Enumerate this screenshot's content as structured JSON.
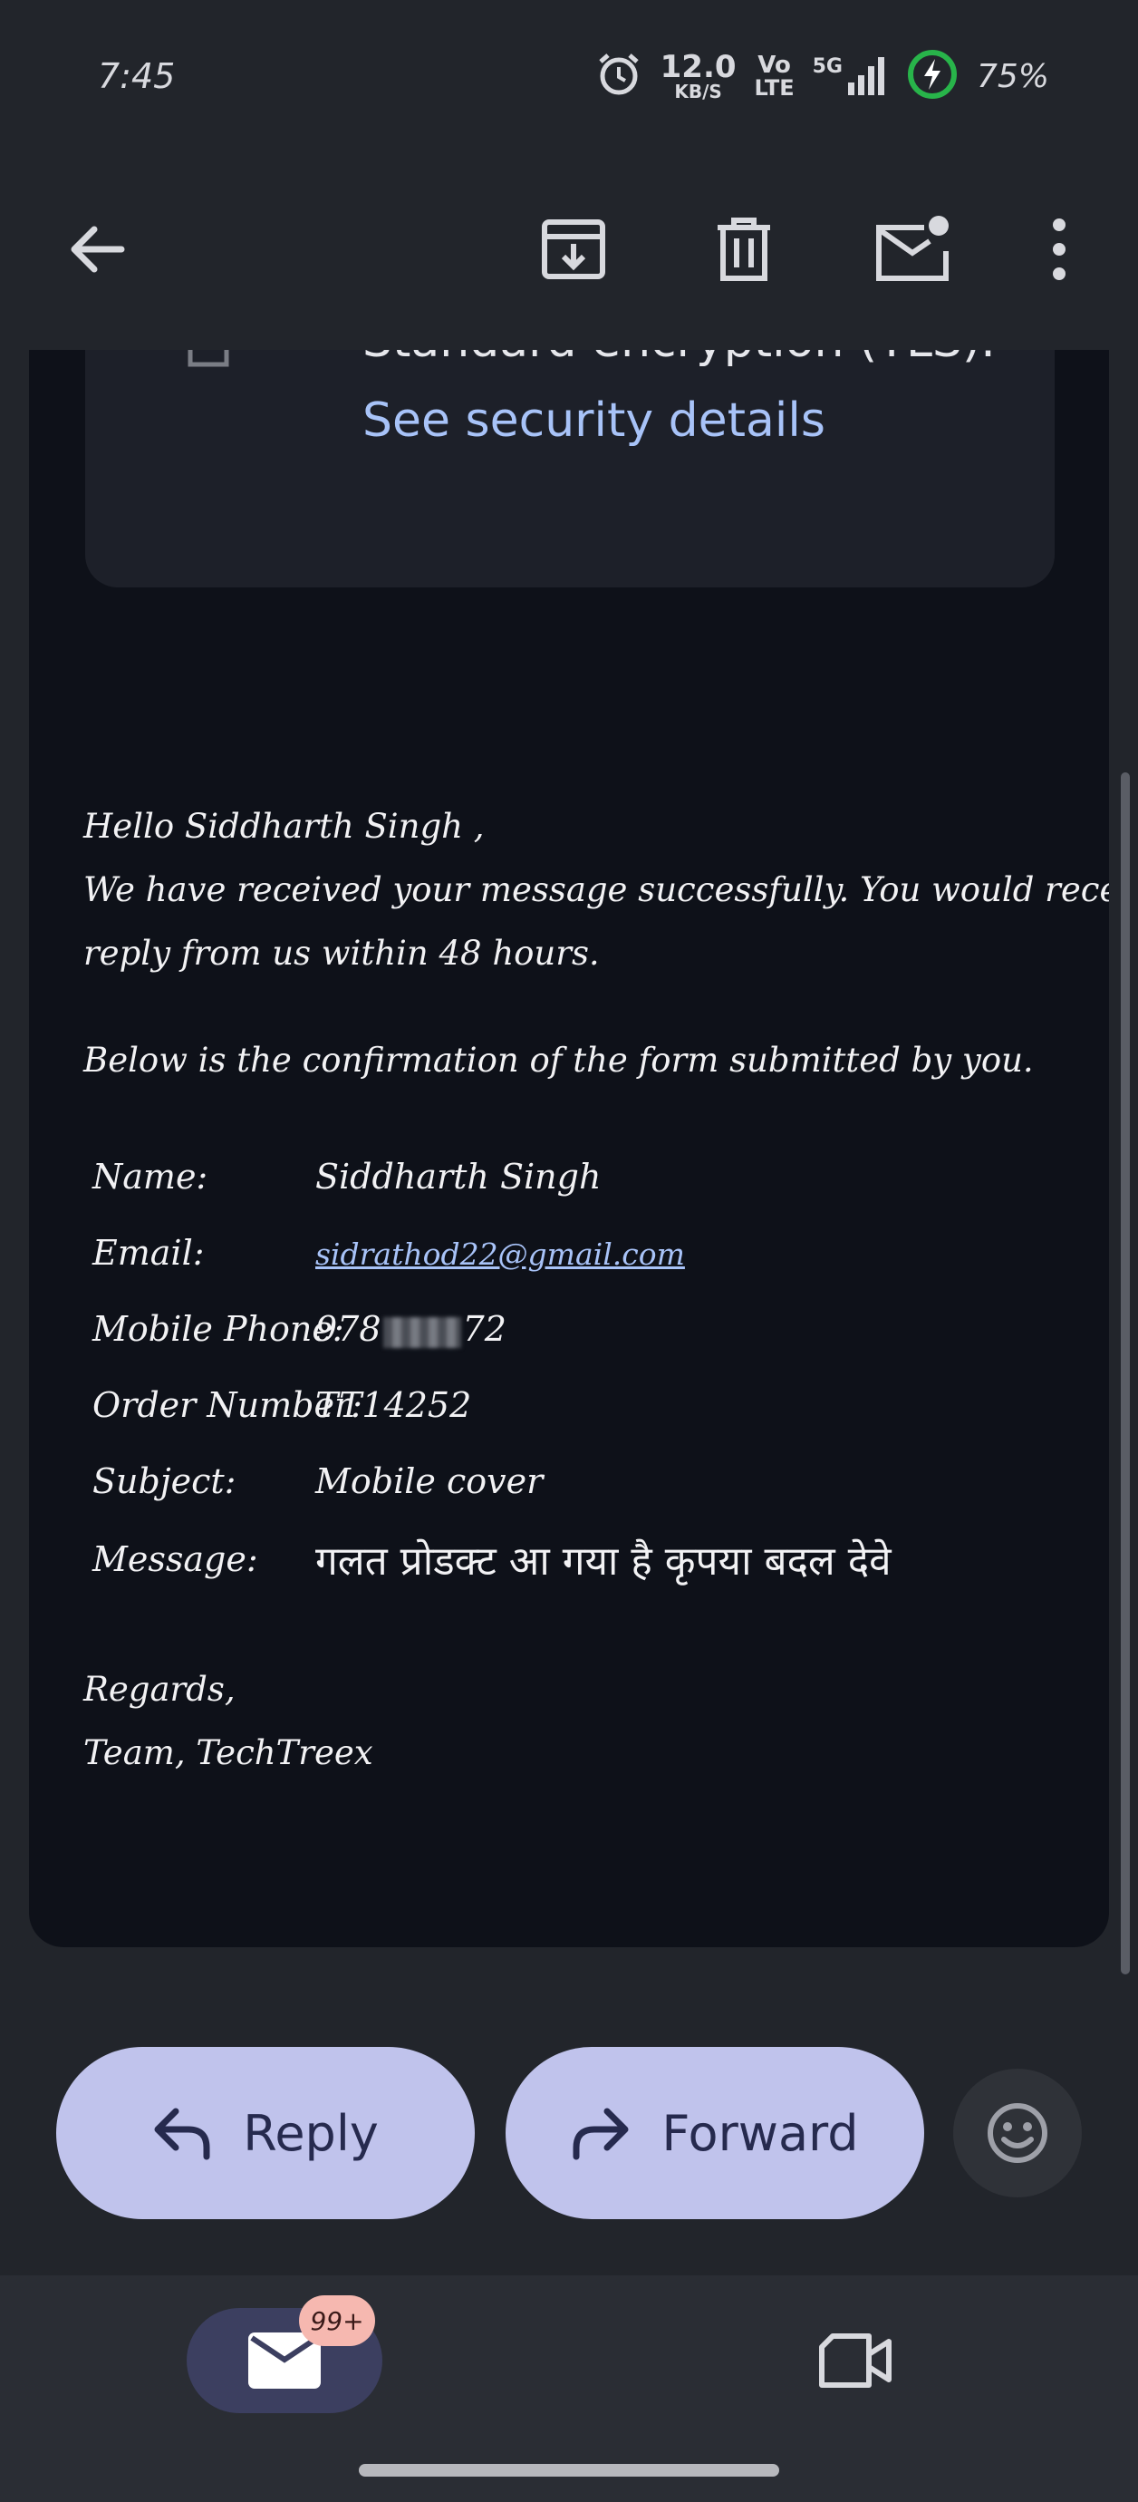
{
  "status_bar": {
    "time": "7:45",
    "net_speed_value": "12.0",
    "net_speed_unit": "KB/S",
    "volte_top": "Vo",
    "volte_bottom": "LTE",
    "network": "5G",
    "battery": "75%",
    "icons": [
      "alarm-icon",
      "signal-icon",
      "battery-icon"
    ]
  },
  "toolbar": {
    "icons": [
      "back-arrow-icon",
      "archive-icon",
      "delete-icon",
      "mark-unread-icon",
      "more-vert-icon"
    ]
  },
  "security": {
    "clipped_text": "Standard encryption (TLS).",
    "link": "See security details"
  },
  "email": {
    "greeting": "Hello Siddharth Singh ,",
    "line1": "We have received your message successfully. You would receive a",
    "line2": "reply from us within 48 hours.",
    "intro": "Below is the confirmation of the form submitted by you.",
    "fields": {
      "name_label": "Name:",
      "name_value": "Siddharth Singh",
      "email_label": "Email:",
      "email_value": "sidrathod22@gmail.com",
      "phone_label": "Mobile Phone:",
      "phone_prefix": "978",
      "phone_suffix": "72",
      "order_label": "Order Number:",
      "order_value": "TT14252",
      "subject_label": "Subject:",
      "subject_value": "Mobile cover",
      "message_label": "Message:",
      "message_value": "गलत प्रोडक्ट आ गया है कृपया बदल देवे"
    },
    "regards": "Regards,",
    "signature": "Team, TechTreex"
  },
  "actions": {
    "reply_label": "Reply",
    "forward_label": "Forward"
  },
  "bottom_nav": {
    "mail_badge": "99+",
    "icons": [
      "mail-icon",
      "video-icon"
    ]
  },
  "colors": {
    "accent_pill": "#c0c3ec",
    "link": "#a8c3f8",
    "badge": "#f6b8b0"
  }
}
